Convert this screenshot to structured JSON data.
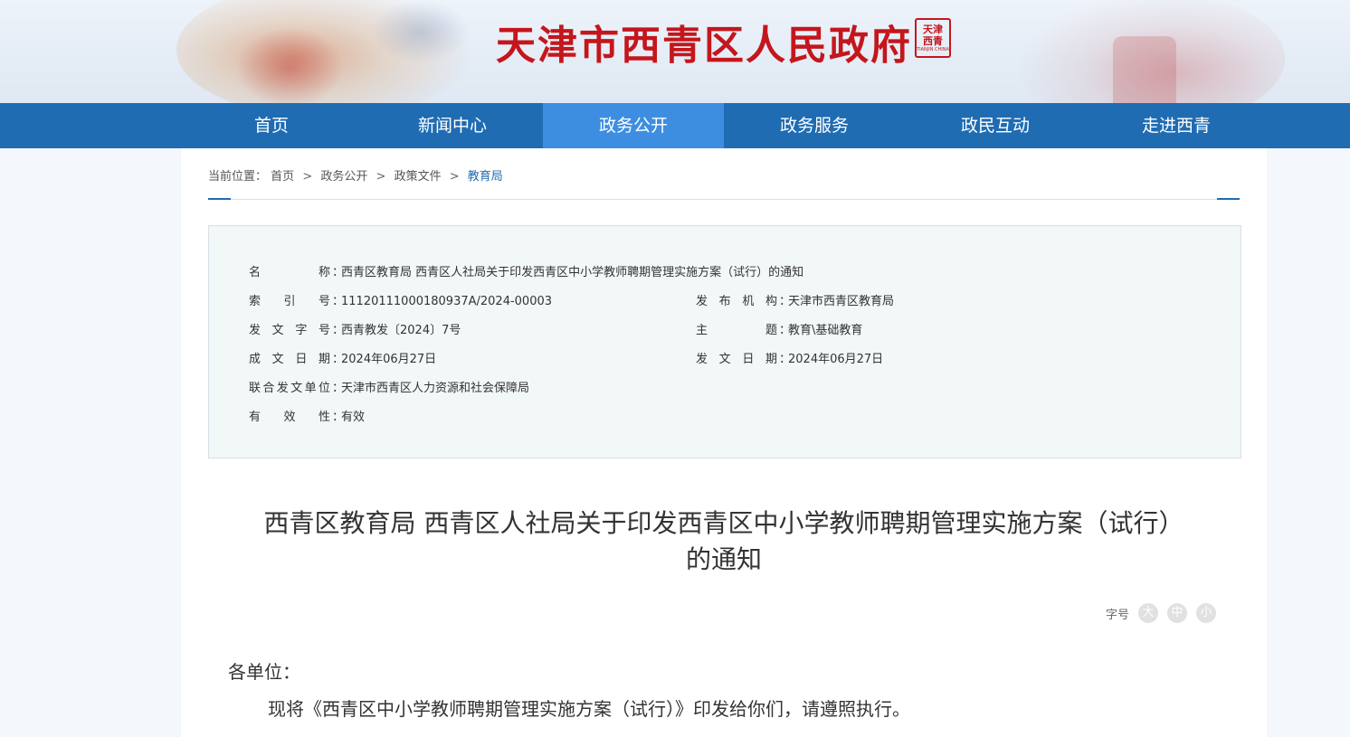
{
  "header": {
    "site_title": "天津市西青区人民政府",
    "seal_text": "天津西青",
    "seal_sub": "TIANJIN CHINA",
    "brand_color": "#c4161c"
  },
  "nav": {
    "items": [
      {
        "label": "首页"
      },
      {
        "label": "新闻中心"
      },
      {
        "label": "政务公开"
      },
      {
        "label": "政务服务"
      },
      {
        "label": "政民互动"
      },
      {
        "label": "走进西青"
      }
    ],
    "active_index": 2,
    "bar_color": "#1f6cb2",
    "active_color": "#3d8ee0"
  },
  "breadcrumb": {
    "prefix": "当前位置：",
    "items": [
      "首页",
      "政务公开",
      "政策文件",
      "教育局"
    ],
    "separator": ">"
  },
  "meta": {
    "name_label": "名称",
    "name_value": "西青区教育局 西青区人社局关于印发西青区中小学教师聘期管理实施方案（试行）的通知",
    "index_label": "索引号",
    "index_value": "11120111000180937A/2024-00003",
    "org_label": "发布机构",
    "org_value": "天津市西青区教育局",
    "docno_label": "发文字号",
    "docno_value": "西青教发〔2024〕7号",
    "topic_label": "主题",
    "topic_value": "教育\\基础教育",
    "created_label": "成文日期",
    "created_value": "2024年06月27日",
    "issued_label": "发文日期",
    "issued_value": "2024年06月27日",
    "joint_label": "联合发文单位",
    "joint_value": "天津市西青区人力资源和社会保障局",
    "valid_label": "有效性",
    "valid_value": "有效",
    "colon": "："
  },
  "document": {
    "title_line1": "西青区教育局 西青区人社局关于印发西青区中小学教师聘期管理实施方案（试行）",
    "title_line2": "的通知",
    "salutation": "各单位：",
    "paragraph": "现将《西青区中小学教师聘期管理实施方案（试行）》印发给你们，请遵照执行。"
  },
  "font_size": {
    "label": "字号",
    "large": "大",
    "medium": "中",
    "small": "小"
  }
}
